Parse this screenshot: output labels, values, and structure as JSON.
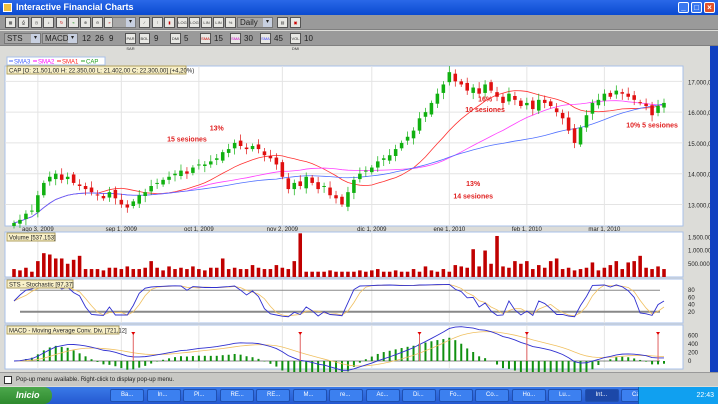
{
  "window": {
    "title": "Interactive Financial Charts"
  },
  "toolbar1": {
    "buttons": [
      "print-preview",
      "print",
      "clock",
      "sound",
      "refresh",
      "rewind",
      "zoom-in",
      "zoom-out",
      "fast-forward"
    ],
    "blank_select": "",
    "chart_types": [
      "line",
      "ohlc",
      "candle"
    ],
    "scales": [
      "LOG",
      "LOG",
      "LIN",
      "LIN",
      "%"
    ],
    "period_select": "Daily"
  },
  "toolbar2": {
    "indicator1": "STS",
    "indicator2": "MACD",
    "macd_params": [
      "12",
      "26",
      "9"
    ],
    "par_sar": "PAR SAR",
    "bol_label": "BOL",
    "bol_val": "9",
    "dmi": "DMI",
    "dmi_val": "5",
    "sma1": "SMA",
    "sma1_val": "15",
    "sma2": "SMA",
    "sma2_val": "30",
    "sma3": "SMA",
    "sma3_val": "45",
    "vol": "VOL DMI",
    "vol_val": "10"
  },
  "legend": [
    {
      "name": "SMA3",
      "color": "#4060ff"
    },
    {
      "name": "SMA2",
      "color": "#ff00ff"
    },
    {
      "name": "SMA1",
      "color": "#ff2020"
    },
    {
      "name": "CAP",
      "color": "#20a020"
    }
  ],
  "info": "CAP [O: 21.501,00  H: 22.350,00  L: 21.402,00  C: 22.300,00] (+4,20%)",
  "annotations": [
    {
      "text": "13%",
      "i": 34,
      "v": 15400
    },
    {
      "text": "15 sesiones",
      "i": 29,
      "v": 15050
    },
    {
      "text": "16%",
      "i": 79,
      "v": 16350
    },
    {
      "text": "10 sesiones",
      "i": 79,
      "v": 16000
    },
    {
      "text": "13%",
      "i": 77,
      "v": 13600
    },
    {
      "text": "14 sesiones",
      "i": 77,
      "v": 13200
    },
    {
      "text": "10% 5 sesiones",
      "i": 107,
      "v": 15500
    }
  ],
  "chart_data": {
    "type": "candlestick",
    "ylim": [
      12300,
      17500
    ],
    "yticks": [
      {
        "v": 13000,
        "label": "13.000,00"
      },
      {
        "v": 14000,
        "label": "14.000,00"
      },
      {
        "v": 15000,
        "label": "15.000,00"
      },
      {
        "v": 16000,
        "label": "16.000,00"
      },
      {
        "v": 17000,
        "label": "17.000,00"
      }
    ],
    "xlabels": [
      {
        "i": 4,
        "label": "ago 3, 2009"
      },
      {
        "i": 18,
        "label": "sep 1, 2009"
      },
      {
        "i": 31,
        "label": "oct 1, 2009"
      },
      {
        "i": 45,
        "label": "nov 2, 2009"
      },
      {
        "i": 60,
        "label": "dic 1, 2009"
      },
      {
        "i": 73,
        "label": "ene 1, 2010"
      },
      {
        "i": 86,
        "label": "feb 1, 2010"
      },
      {
        "i": 99,
        "label": "mar 1, 2010"
      }
    ],
    "close": [
      12400,
      12500,
      12700,
      12800,
      13300,
      13700,
      13900,
      14000,
      13800,
      13900,
      13700,
      13600,
      13500,
      13400,
      13300,
      13200,
      13400,
      13200,
      13000,
      12900,
      13100,
      13300,
      13400,
      13600,
      13700,
      13800,
      13900,
      14000,
      14100,
      14000,
      14200,
      14300,
      14300,
      14400,
      14500,
      14700,
      14800,
      15000,
      14900,
      14800,
      14900,
      14800,
      14600,
      14500,
      14300,
      13900,
      13500,
      13700,
      13600,
      13900,
      13700,
      13500,
      13600,
      13300,
      13200,
      13000,
      13400,
      13800,
      14000,
      14100,
      14200,
      14400,
      14500,
      14600,
      14800,
      15000,
      15200,
      15400,
      15800,
      16000,
      16300,
      16600,
      16900,
      17300,
      17000,
      16900,
      16700,
      16800,
      16600,
      16900,
      16700,
      16500,
      16300,
      16600,
      16400,
      16200,
      16300,
      16100,
      16400,
      16300,
      16200,
      16000,
      15800,
      15400,
      15000,
      15500,
      15900,
      16300,
      16400,
      16600,
      16500,
      16700,
      16600,
      16500,
      16400,
      16300,
      16200,
      15900,
      16200,
      16300
    ],
    "volume": {
      "title": "Volume [537.153]",
      "ylim": [
        0,
        1700000
      ],
      "yticks": [
        {
          "v": 500000,
          "label": "500.000"
        },
        {
          "v": 1000000,
          "label": "1.000.000"
        },
        {
          "v": 1500000,
          "label": "1.500.000"
        }
      ],
      "values": [
        300,
        250,
        350,
        200,
        600,
        900,
        850,
        700,
        700,
        500,
        650,
        800,
        300,
        300,
        300,
        250,
        350,
        350,
        300,
        400,
        300,
        300,
        350,
        600,
        350,
        250,
        400,
        300,
        350,
        300,
        400,
        300,
        250,
        350,
        350,
        700,
        300,
        350,
        300,
        300,
        450,
        350,
        300,
        300,
        450,
        350,
        300,
        600,
        1650,
        200,
        200,
        200,
        200,
        250,
        200,
        200,
        200,
        200,
        250,
        200,
        250,
        300,
        200,
        200,
        250,
        200,
        200,
        300,
        200,
        400,
        250,
        200,
        300,
        200,
        450,
        400,
        350,
        1050,
        400,
        1000,
        500,
        1550,
        400,
        350,
        600,
        500,
        600,
        300,
        450,
        350,
        600,
        700,
        300,
        350,
        250,
        300,
        350,
        550,
        250,
        350,
        450,
        600,
        300,
        550,
        600,
        800,
        350,
        300,
        400,
        300,
        150
      ]
    },
    "stochastic": {
      "title": "STS - Stochastic [97,37]",
      "yticks": [
        20,
        40,
        60,
        80
      ]
    },
    "macd": {
      "title": "MACD - Moving Average Conv. Div. [721,12]",
      "yticks": [
        {
          "v": 0,
          "label": "0"
        },
        {
          "v": 200,
          "label": "200"
        },
        {
          "v": 400,
          "label": "400"
        },
        {
          "v": 600,
          "label": "600"
        }
      ]
    }
  },
  "status": "Pop-up menu available. Right-click to display pop-up menu.",
  "taskbar": {
    "start": "Inicio",
    "tasks": [
      "Ba...",
      "In...",
      "Pl...",
      "RE...",
      "RE...",
      "M...",
      "re...",
      "Ac...",
      "Di...",
      "Fo...",
      "Co...",
      "Ho...",
      "Lu...",
      "Int...",
      "Ca..."
    ],
    "time": "22:43"
  }
}
